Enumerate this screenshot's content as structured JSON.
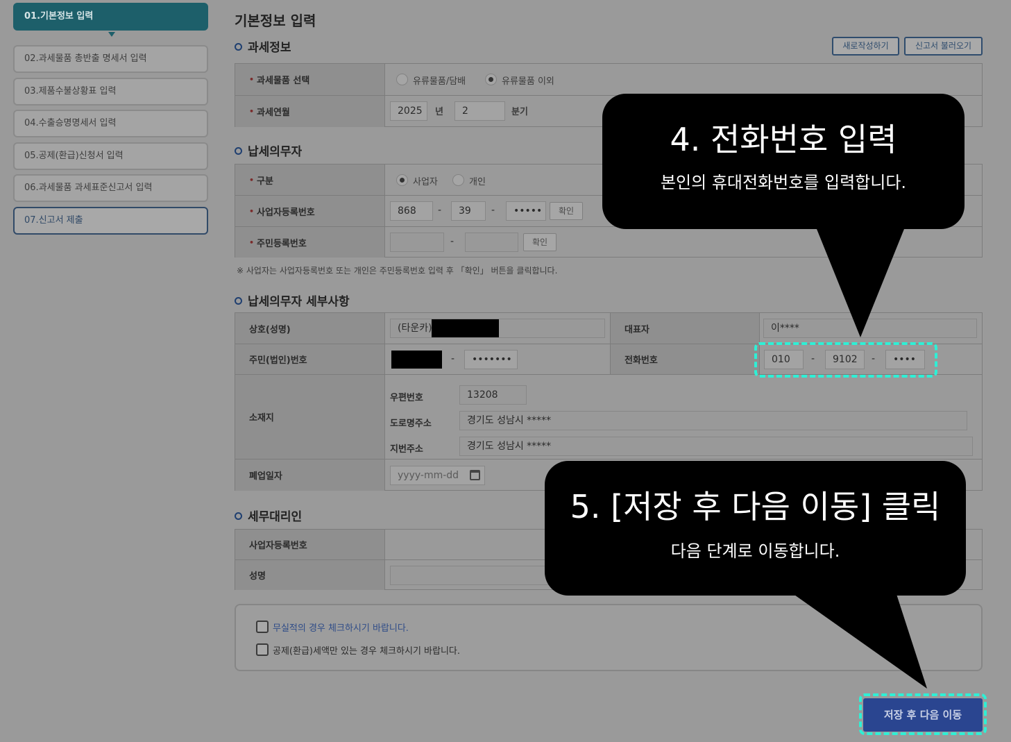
{
  "sidebar": {
    "steps": [
      "01.기본정보 입력",
      "02.과세물품 총반출 명세서 입력",
      "03.제품수불상황표 입력",
      "04.수출승명명세서 입력",
      "05.공제(환급)신청서 입력",
      "06.과세물품 과세표준신고서 입력",
      "07.신고서 제출"
    ]
  },
  "page": {
    "title": "기본정보 입력",
    "new_button": "새로작성하기",
    "load_button": "신고서 불러오기"
  },
  "tax_info": {
    "section": "과세정보",
    "goods_label": "과세물품 선택",
    "goods_option1": "유류물품/담배",
    "goods_option2": "유류물품 이외",
    "goods_selected": "유류물품 이외",
    "period_label": "과세연월",
    "year": "2025",
    "year_unit": "년",
    "quarter": "2",
    "quarter_unit": "분기"
  },
  "taxpayer": {
    "section": "납세의무자",
    "type_label": "구분",
    "type_option1": "사업자",
    "type_option2": "개인",
    "type_selected": "사업자",
    "brn_label": "사업자등록번호",
    "brn1": "868",
    "brn2": "39",
    "brn3": "•••••",
    "confirm": "확인",
    "rrn_label": "주민등록번호",
    "dash": "-",
    "note": "※ 사업자는 사업자등록번호 또는 개인은 주민등록번호 입력 후 「확인」 버튼을 클릭합니다."
  },
  "details": {
    "section": "납세의무자 세부사항",
    "company_label": "상호(성명)",
    "company_value": "(타운카)",
    "rep_label": "대표자",
    "rep_value": "이****",
    "rrn_label": "주민(법인)번호",
    "rrn_tail": "•••••••",
    "phone_label": "전화번호",
    "phone1": "010",
    "phone2": "9102",
    "phone3": "••••",
    "address_label": "소재지",
    "zip_label": "우편번호",
    "zip": "13208",
    "road_label": "도로명주소",
    "road": "경기도 성남시 *****",
    "lot_label": "지번주소",
    "lot": "경기도 성남시 *****",
    "closed_label": "폐업일자",
    "closed_placeholder": "yyyy-mm-dd"
  },
  "agent": {
    "section": "세무대리인",
    "brn_label": "사업자등록번호",
    "name_label": "성명"
  },
  "checks": {
    "nil_return": "무실적의 경우 체크하시기 바랍니다.",
    "refund_only": "공제(환급)세액만 있는 경우 체크하시기 바랍니다."
  },
  "save_button": "저장 후 다음 이동",
  "callouts": {
    "c4_title": "4. 전화번호 입력",
    "c4_desc": "본인의 휴대전화번호를 입력합니다.",
    "c5_title": "5. [저장 후 다음 이동] 클릭",
    "c5_desc": "다음 단계로 이동합니다."
  },
  "colors": {
    "highlight": "#2ef0d6",
    "primary": "#2a4590",
    "active_step": "#1d5f6a"
  }
}
